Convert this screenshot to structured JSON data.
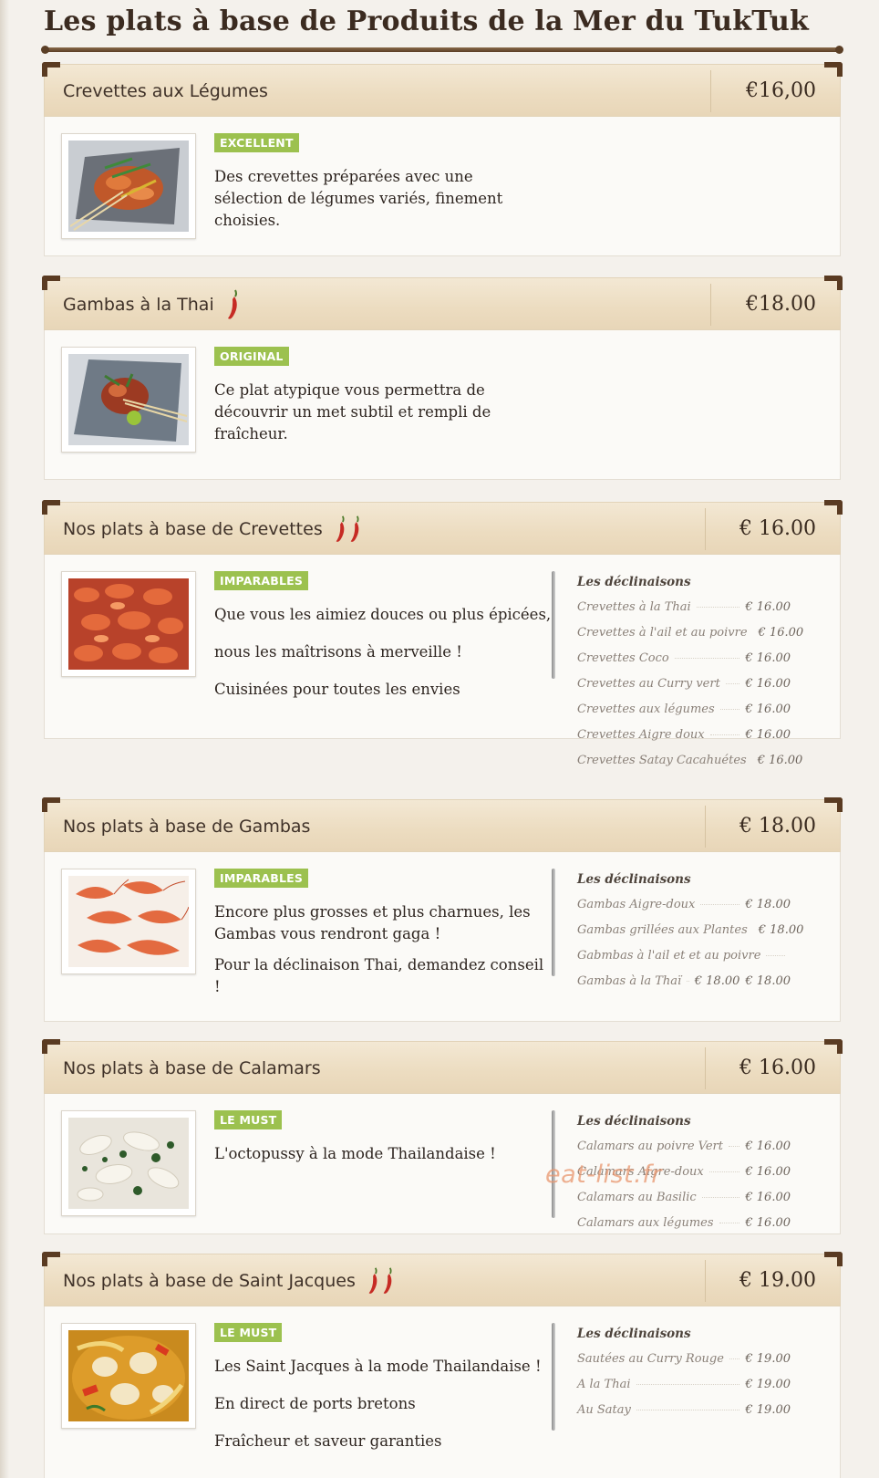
{
  "page": {
    "title": "Les plats à base de Produits de la Mer du TukTuk",
    "watermark": "eat-list.fr",
    "badge_color": "#9cc14f",
    "header_color": "#ecdcc0"
  },
  "dishes": [
    {
      "name": "Crevettes aux Légumes",
      "price": "€16,00",
      "chili_count": 0,
      "photo_icon": "shrimp-vegetables-plate",
      "badge": "EXCELLENT",
      "description": [
        "Des crevettes préparées avec une sélection de légumes variés, finement choisies."
      ]
    },
    {
      "name": "Gambas à la Thai",
      "price": "€18.00",
      "chili_count": 1,
      "photo_icon": "gambas-thai-plate",
      "badge": "ORIGINAL",
      "description": [
        "Ce plat atypique vous permettra de découvrir un met subtil et rempli de fraîcheur."
      ]
    },
    {
      "name": "Nos plats à base de Crevettes",
      "price": "€ 16.00",
      "chili_count": 2,
      "photo_icon": "shrimps-pile",
      "badge": "IMPARABLES",
      "description": [
        "Que vous les aimiez douces ou plus épicées,",
        "nous les maîtrisons à merveille !",
        "Cuisinées pour toutes les envies"
      ],
      "declinaisons": {
        "title": "Les déclinaisons",
        "items": [
          {
            "name": "Crevettes à la Thai",
            "price": "€ 16.00"
          },
          {
            "name": "Crevettes à l'ail et au poivre",
            "price": "€ 16.00"
          },
          {
            "name": "Crevettes Coco",
            "price": "€ 16.00"
          },
          {
            "name": "Crevettes au Curry vert",
            "price": "€ 16.00"
          },
          {
            "name": "Crevettes aux légumes",
            "price": "€ 16.00"
          },
          {
            "name": "Crevettes Aigre doux",
            "price": "€ 16.00"
          },
          {
            "name": "Crevettes Satay Cacahuétes",
            "price": "€ 16.00"
          }
        ]
      }
    },
    {
      "name": "Nos plats à base de Gambas",
      "price": "€ 18.00",
      "chili_count": 0,
      "photo_icon": "gambas-pile",
      "badge": "IMPARABLES",
      "description": [
        "Encore plus grosses et plus charnues, les Gambas vous rendront gaga !",
        "Pour la déclinaison Thai, demandez conseil !"
      ],
      "declinaisons": {
        "title": "Les déclinaisons",
        "items": [
          {
            "name": "Gambas Aigre-doux",
            "price": "€ 18.00"
          },
          {
            "name": "Gambas grillées aux Plantes",
            "price": "€ 18.00"
          },
          {
            "name": "Gabmbas à l'ail et et au poivre",
            "price": "€ 18.00"
          },
          {
            "name": "Gambas à la Thaï",
            "price": "€ 18.00"
          }
        ]
      }
    },
    {
      "name": "Nos plats à base de Calamars",
      "price": "€ 16.00",
      "chili_count": 0,
      "photo_icon": "calamari-plate",
      "badge": "LE MUST",
      "description": [
        "L'octopussy à la mode Thailandaise !"
      ],
      "declinaisons": {
        "title": "Les déclinaisons",
        "items": [
          {
            "name": "Calamars au poivre Vert",
            "price": "€ 16.00"
          },
          {
            "name": "Calamars Aigre-doux",
            "price": "€ 16.00"
          },
          {
            "name": "Calamars au Basilic",
            "price": "€ 16.00"
          },
          {
            "name": "Calamars aux légumes",
            "price": "€ 16.00"
          }
        ]
      }
    },
    {
      "name": "Nos plats à base de Saint Jacques",
      "price": "€ 19.00",
      "chili_count": 2,
      "photo_icon": "scallops-curry",
      "badge": "LE MUST",
      "description": [
        "Les Saint Jacques à la mode Thailandaise !",
        "En direct de ports bretons",
        "Fraîcheur et saveur garanties"
      ],
      "declinaisons": {
        "title": "Les déclinaisons",
        "items": [
          {
            "name": "Sautées au Curry Rouge",
            "price": "€ 19.00"
          },
          {
            "name": "A la Thai",
            "price": "€ 19.00"
          },
          {
            "name": "Au Satay",
            "price": "€ 19.00"
          }
        ]
      }
    }
  ]
}
